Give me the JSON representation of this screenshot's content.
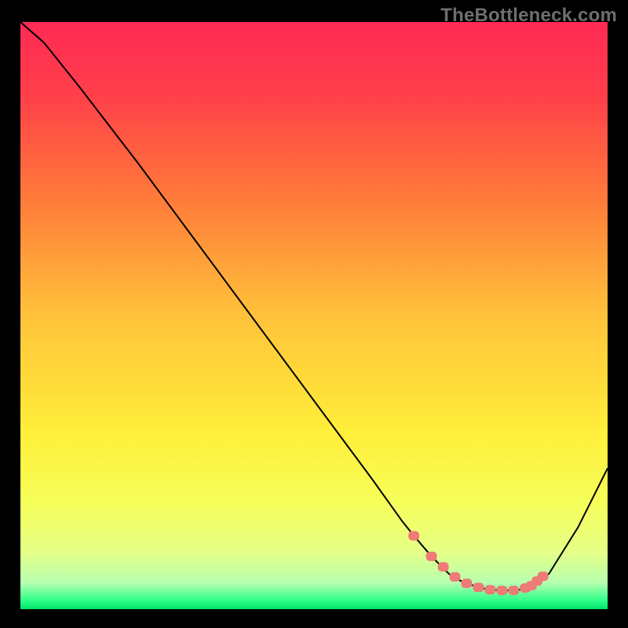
{
  "watermark": "TheBottleneck.com",
  "chart_data": {
    "type": "line",
    "title": "",
    "xlabel": "",
    "ylabel": "",
    "xlim": [
      0,
      100
    ],
    "ylim": [
      0,
      100
    ],
    "grid": false,
    "series": [
      {
        "name": "bottleneck-curve",
        "x": [
          0,
          4,
          6,
          10,
          20,
          30,
          40,
          50,
          60,
          65,
          67,
          70,
          73,
          75,
          78,
          80,
          83,
          85,
          87,
          90,
          95,
          100
        ],
        "y": [
          100,
          96.5,
          94,
          89,
          76,
          62.5,
          49,
          35.5,
          22,
          15,
          12.5,
          9,
          6,
          4.8,
          3.7,
          3.3,
          3.2,
          3.3,
          4,
          6,
          14,
          24
        ]
      }
    ],
    "dots": {
      "name": "sweet-spot-band",
      "color": "#ee7b76",
      "x": [
        67,
        70,
        72,
        74,
        76,
        78,
        80,
        82,
        84,
        86,
        87,
        88,
        89
      ],
      "y": [
        12.5,
        9,
        7.2,
        5.5,
        4.4,
        3.7,
        3.3,
        3.2,
        3.2,
        3.6,
        4,
        4.8,
        5.6
      ]
    },
    "gradient_stops": [
      {
        "offset": 0.0,
        "color": "#ff2a55"
      },
      {
        "offset": 0.12,
        "color": "#ff3e4a"
      },
      {
        "offset": 0.3,
        "color": "#ff7a3a"
      },
      {
        "offset": 0.5,
        "color": "#ffc23a"
      },
      {
        "offset": 0.7,
        "color": "#ffef3a"
      },
      {
        "offset": 0.82,
        "color": "#f6ff5a"
      },
      {
        "offset": 0.9,
        "color": "#e6ff85"
      },
      {
        "offset": 0.955,
        "color": "#b8ffb0"
      },
      {
        "offset": 0.985,
        "color": "#2fff8a"
      },
      {
        "offset": 1.0,
        "color": "#00e46a"
      }
    ]
  }
}
